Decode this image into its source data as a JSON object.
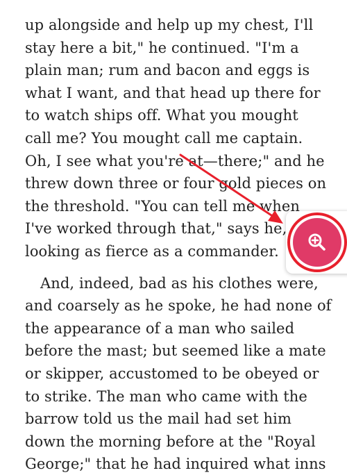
{
  "book": {
    "lines": [
      "up alongside and help up my chest, I'll",
      "stay here a bit,\" he continued. \"I'm a",
      "plain man; rum and bacon and eggs is",
      "what I want, and that head up there for",
      "to watch ships off. What you mought",
      "call me? You mought call me captain.",
      "Oh, I see what you're at—there;\" and he",
      "threw down three or four gold pieces on",
      "the threshold. \"You can tell me when",
      "I've worked through that,\" says he,",
      "looking as fierce as a commander.",
      "And, indeed, bad as his clothes were,",
      "and coarsely as he spoke, he had none of",
      "the appearance of a man who sailed",
      "before the mast; but seemed like a mate",
      "or skipper, accustomed to be obeyed or",
      "to strike. The man who came with the",
      "barrow told us the mail had set him",
      "down the morning before at the \"Royal",
      "George;\" that he had inquired what inns"
    ]
  },
  "zoom_button": {
    "icon": "zoom-in-icon",
    "color": "#e03a67",
    "highlight_ring_color": "#e8202c"
  },
  "annotation": {
    "arrow_color": "#e8202c"
  }
}
